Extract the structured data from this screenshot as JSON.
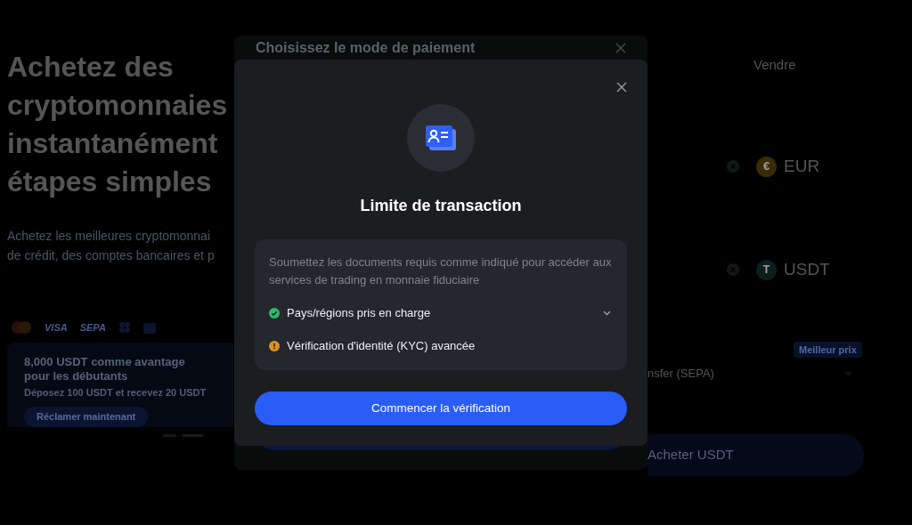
{
  "background_page": {
    "headline_lines": [
      "Achetez des",
      "cryptomonnaies",
      "instantanément",
      "étapes simples"
    ],
    "intro_lines": [
      "Achetez les meilleures cryptomonnai",
      "de crédit, des comptes bancaires et p"
    ],
    "payment_logos": [
      {
        "kind": "mastercard"
      },
      {
        "kind": "wordmark",
        "label": "VISA"
      },
      {
        "kind": "wordmark",
        "label": "SEPA"
      },
      {
        "kind": "dots"
      },
      {
        "kind": "wallet"
      }
    ],
    "promo": {
      "title": "8,000 USDT comme avantage pour les débutants",
      "subtitle": "Déposez 100 USDT et recevez 20 USDT",
      "button": "Réclamer maintenant"
    },
    "carousel_dots": [
      {
        "selected": true
      },
      {
        "selected": false
      }
    ]
  },
  "trade_panel": {
    "tab": "Vendre",
    "currencies": [
      {
        "code": "EUR",
        "coin": "€",
        "color": "#3a2a08"
      },
      {
        "code": "USDT",
        "coin": "T",
        "color": "#0c1f1a"
      }
    ],
    "badge": "Meilleur prix",
    "payment_method": "nsfer (SEPA)",
    "buy_button": "Acheter USDT"
  },
  "payment_modal": {
    "title": "Choisissez le mode de paiement"
  },
  "limit_modal": {
    "title": "Limite de transaction",
    "description": "Soumettez les documents requis comme indiqué pour accéder aux services de trading en monnaie fiduciaire",
    "requirements": [
      {
        "label": "Pays/régions pris en charge",
        "kind": "done",
        "expandable": true
      },
      {
        "label": "Vérification d'identité (KYC) avancée",
        "kind": "pending",
        "expandable": false
      }
    ],
    "button": "Commencer la vérification"
  }
}
